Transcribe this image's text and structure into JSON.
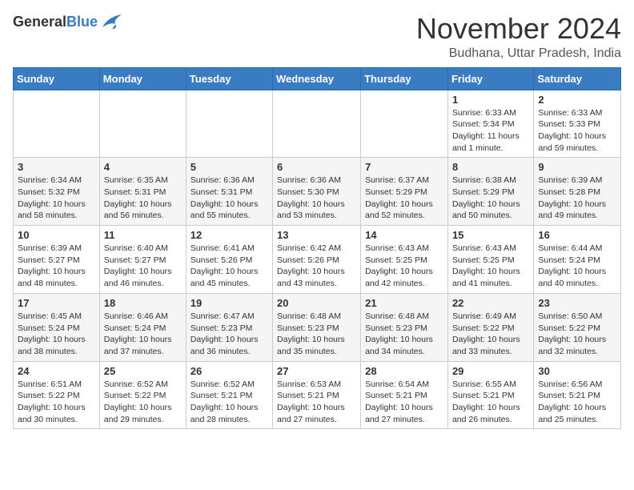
{
  "header": {
    "logo_general": "General",
    "logo_blue": "Blue",
    "month": "November 2024",
    "location": "Budhana, Uttar Pradesh, India"
  },
  "days_of_week": [
    "Sunday",
    "Monday",
    "Tuesday",
    "Wednesday",
    "Thursday",
    "Friday",
    "Saturday"
  ],
  "weeks": [
    [
      {
        "day": "",
        "info": ""
      },
      {
        "day": "",
        "info": ""
      },
      {
        "day": "",
        "info": ""
      },
      {
        "day": "",
        "info": ""
      },
      {
        "day": "",
        "info": ""
      },
      {
        "day": "1",
        "info": "Sunrise: 6:33 AM\nSunset: 5:34 PM\nDaylight: 11 hours and 1 minute."
      },
      {
        "day": "2",
        "info": "Sunrise: 6:33 AM\nSunset: 5:33 PM\nDaylight: 10 hours and 59 minutes."
      }
    ],
    [
      {
        "day": "3",
        "info": "Sunrise: 6:34 AM\nSunset: 5:32 PM\nDaylight: 10 hours and 58 minutes."
      },
      {
        "day": "4",
        "info": "Sunrise: 6:35 AM\nSunset: 5:31 PM\nDaylight: 10 hours and 56 minutes."
      },
      {
        "day": "5",
        "info": "Sunrise: 6:36 AM\nSunset: 5:31 PM\nDaylight: 10 hours and 55 minutes."
      },
      {
        "day": "6",
        "info": "Sunrise: 6:36 AM\nSunset: 5:30 PM\nDaylight: 10 hours and 53 minutes."
      },
      {
        "day": "7",
        "info": "Sunrise: 6:37 AM\nSunset: 5:29 PM\nDaylight: 10 hours and 52 minutes."
      },
      {
        "day": "8",
        "info": "Sunrise: 6:38 AM\nSunset: 5:29 PM\nDaylight: 10 hours and 50 minutes."
      },
      {
        "day": "9",
        "info": "Sunrise: 6:39 AM\nSunset: 5:28 PM\nDaylight: 10 hours and 49 minutes."
      }
    ],
    [
      {
        "day": "10",
        "info": "Sunrise: 6:39 AM\nSunset: 5:27 PM\nDaylight: 10 hours and 48 minutes."
      },
      {
        "day": "11",
        "info": "Sunrise: 6:40 AM\nSunset: 5:27 PM\nDaylight: 10 hours and 46 minutes."
      },
      {
        "day": "12",
        "info": "Sunrise: 6:41 AM\nSunset: 5:26 PM\nDaylight: 10 hours and 45 minutes."
      },
      {
        "day": "13",
        "info": "Sunrise: 6:42 AM\nSunset: 5:26 PM\nDaylight: 10 hours and 43 minutes."
      },
      {
        "day": "14",
        "info": "Sunrise: 6:43 AM\nSunset: 5:25 PM\nDaylight: 10 hours and 42 minutes."
      },
      {
        "day": "15",
        "info": "Sunrise: 6:43 AM\nSunset: 5:25 PM\nDaylight: 10 hours and 41 minutes."
      },
      {
        "day": "16",
        "info": "Sunrise: 6:44 AM\nSunset: 5:24 PM\nDaylight: 10 hours and 40 minutes."
      }
    ],
    [
      {
        "day": "17",
        "info": "Sunrise: 6:45 AM\nSunset: 5:24 PM\nDaylight: 10 hours and 38 minutes."
      },
      {
        "day": "18",
        "info": "Sunrise: 6:46 AM\nSunset: 5:24 PM\nDaylight: 10 hours and 37 minutes."
      },
      {
        "day": "19",
        "info": "Sunrise: 6:47 AM\nSunset: 5:23 PM\nDaylight: 10 hours and 36 minutes."
      },
      {
        "day": "20",
        "info": "Sunrise: 6:48 AM\nSunset: 5:23 PM\nDaylight: 10 hours and 35 minutes."
      },
      {
        "day": "21",
        "info": "Sunrise: 6:48 AM\nSunset: 5:23 PM\nDaylight: 10 hours and 34 minutes."
      },
      {
        "day": "22",
        "info": "Sunrise: 6:49 AM\nSunset: 5:22 PM\nDaylight: 10 hours and 33 minutes."
      },
      {
        "day": "23",
        "info": "Sunrise: 6:50 AM\nSunset: 5:22 PM\nDaylight: 10 hours and 32 minutes."
      }
    ],
    [
      {
        "day": "24",
        "info": "Sunrise: 6:51 AM\nSunset: 5:22 PM\nDaylight: 10 hours and 30 minutes."
      },
      {
        "day": "25",
        "info": "Sunrise: 6:52 AM\nSunset: 5:22 PM\nDaylight: 10 hours and 29 minutes."
      },
      {
        "day": "26",
        "info": "Sunrise: 6:52 AM\nSunset: 5:21 PM\nDaylight: 10 hours and 28 minutes."
      },
      {
        "day": "27",
        "info": "Sunrise: 6:53 AM\nSunset: 5:21 PM\nDaylight: 10 hours and 27 minutes."
      },
      {
        "day": "28",
        "info": "Sunrise: 6:54 AM\nSunset: 5:21 PM\nDaylight: 10 hours and 27 minutes."
      },
      {
        "day": "29",
        "info": "Sunrise: 6:55 AM\nSunset: 5:21 PM\nDaylight: 10 hours and 26 minutes."
      },
      {
        "day": "30",
        "info": "Sunrise: 6:56 AM\nSunset: 5:21 PM\nDaylight: 10 hours and 25 minutes."
      }
    ]
  ]
}
